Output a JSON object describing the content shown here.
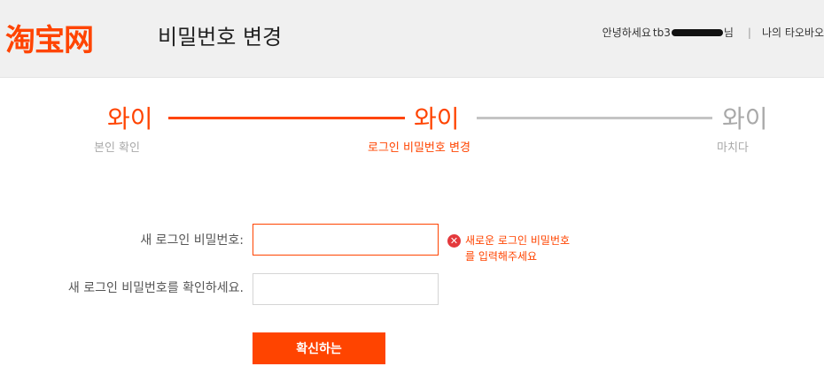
{
  "header": {
    "logo": "淘宝网",
    "title": "비밀번호 변경",
    "greeting": "안녕하세요",
    "username_prefix": "tb3",
    "username_suffix": "님",
    "separator": "|",
    "my_taobao": "나의 타오바오"
  },
  "steps": [
    {
      "label": "와이",
      "sub": "본인 확인"
    },
    {
      "label": "와이",
      "sub": "로그인 비밀번호 변경"
    },
    {
      "label": "와이",
      "sub": "마치다"
    }
  ],
  "form": {
    "new_password_label": "새 로그인 비밀번호:",
    "new_password_value": "",
    "confirm_password_label": "새 로그인 비밀번호를 확인하세요.",
    "confirm_password_value": "",
    "error_message": "새로운 로그인 비밀번호를 입력해주세요",
    "submit_label": "확신하는"
  },
  "colors": {
    "accent": "#ff4400",
    "inactive": "#a9a9a9",
    "error_icon": "#e4393c"
  }
}
